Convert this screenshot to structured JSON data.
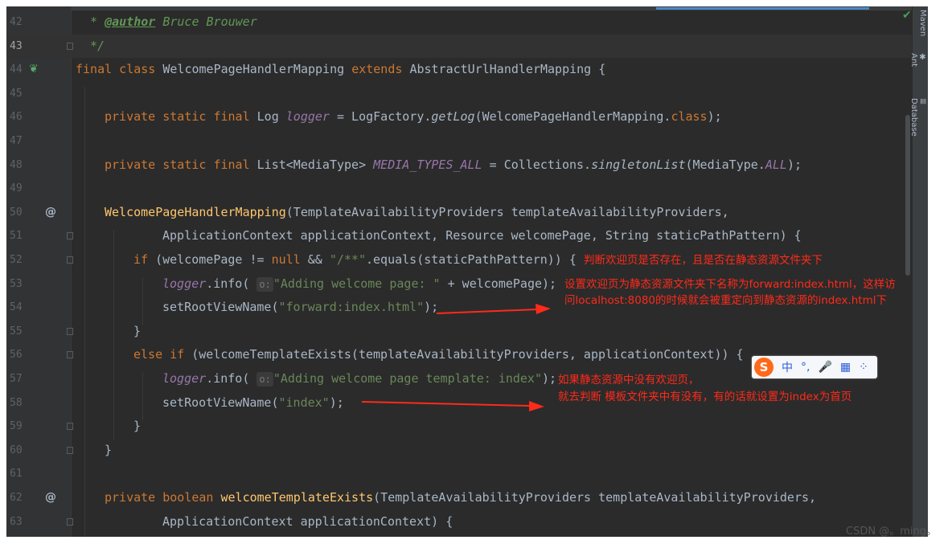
{
  "editor": {
    "lines": [
      {
        "num": "42"
      },
      {
        "num": "43"
      },
      {
        "num": "44"
      },
      {
        "num": "45"
      },
      {
        "num": "46"
      },
      {
        "num": "47"
      },
      {
        "num": "48"
      },
      {
        "num": "49"
      },
      {
        "num": "50"
      },
      {
        "num": "51"
      },
      {
        "num": "52"
      },
      {
        "num": "53"
      },
      {
        "num": "54"
      },
      {
        "num": "55"
      },
      {
        "num": "56"
      },
      {
        "num": "57"
      },
      {
        "num": "58"
      },
      {
        "num": "59"
      },
      {
        "num": "60"
      },
      {
        "num": "61"
      },
      {
        "num": "62"
      },
      {
        "num": "63"
      }
    ],
    "code": {
      "l42_star": " * ",
      "l42_tag": "@author",
      "l42_text": " Bruce Brouwer",
      "l43": " */",
      "l44_kw": "final class ",
      "l44_name": "WelcomePageHandlerMapping ",
      "l44_kw2": "extends ",
      "l44_rest": "AbstractUrlHandlerMapping {",
      "l46_kw": "private static final ",
      "l46_type": "Log ",
      "l46_var": "logger",
      "l46_eq": " = LogFactory.",
      "l46_m": "getLog",
      "l46_arg": "(WelcomePageHandlerMapping.",
      "l46_cls": "class",
      "l46_end": ");",
      "l48_kw": "private static final ",
      "l48_type": "List<MediaType> ",
      "l48_var": "MEDIA_TYPES_ALL",
      "l48_eq": " = Collections.",
      "l48_m": "singletonList",
      "l48_arg": "(MediaType.",
      "l48_all": "ALL",
      "l48_end": ");",
      "l50_name": "WelcomePageHandlerMapping",
      "l50_rest": "(TemplateAvailabilityProviders templateAvailabilityProviders,",
      "l51": "ApplicationContext applicationContext, Resource welcomePage, String staticPathPattern) {",
      "l52_if": "if ",
      "l52_a": "(welcomePage != ",
      "l52_null": "null",
      "l52_b": " && ",
      "l52_str": "\"/**\"",
      "l52_c": ".equals(staticPathPattern)) {",
      "l53_logger": "logger",
      "l53_a": ".info( ",
      "l53_hint": "o:",
      "l53_str": "\"Adding welcome page: \"",
      "l53_b": " + welcomePage);",
      "l54_a": "setRootViewName(",
      "l54_str": "\"forward:index.html\"",
      "l54_b": ");",
      "l55": "}",
      "l56_else": "else if ",
      "l56_rest": "(welcomeTemplateExists(templateAvailabilityProviders, applicationContext)) {",
      "l57_logger": "logger",
      "l57_a": ".info( ",
      "l57_hint": "o:",
      "l57_str": "\"Adding welcome page template: index\"",
      "l57_b": ");",
      "l58_a": "setRootViewName(",
      "l58_str": "\"index\"",
      "l58_b": ");",
      "l59": "}",
      "l60": "}",
      "l62_kw": "private boolean ",
      "l62_name": "welcomeTemplateExists",
      "l62_rest": "(TemplateAvailabilityProviders templateAvailabilityProviders,",
      "l63": "ApplicationContext applicationContext) {"
    },
    "gutter_markers": {
      "l50": "@",
      "l62": "@"
    }
  },
  "right_panel": {
    "tabs": [
      {
        "label": "Maven"
      },
      {
        "label": "Ant"
      },
      {
        "label": "Database"
      }
    ]
  },
  "annotations": {
    "a1": "判断欢迎页是否存在，且是否在静态资源文件夹下",
    "a2_line1": "设置欢迎页为静态资源文件夹下名称为forward:index.html，这样访",
    "a2_line2": "问localhost:8080的时候就会被重定向到静态资源的index.html下",
    "a3_line1": "如果静态资源中没有欢迎页，",
    "a3_line2": "就去判断 模板文件夹中有没有，有的话就设置为index为首页"
  },
  "ime_toolbar": {
    "logo": "S",
    "items": [
      "中",
      "°,",
      "🎤",
      "▦",
      "⁘"
    ]
  },
  "watermark": "CSDN @。ming。",
  "colors": {
    "editor_bg": "#2b2b2b",
    "keyword": "#cc7832",
    "function": "#ffc66d",
    "string": "#6a8759",
    "annotation_red": "#ff2a1a"
  }
}
